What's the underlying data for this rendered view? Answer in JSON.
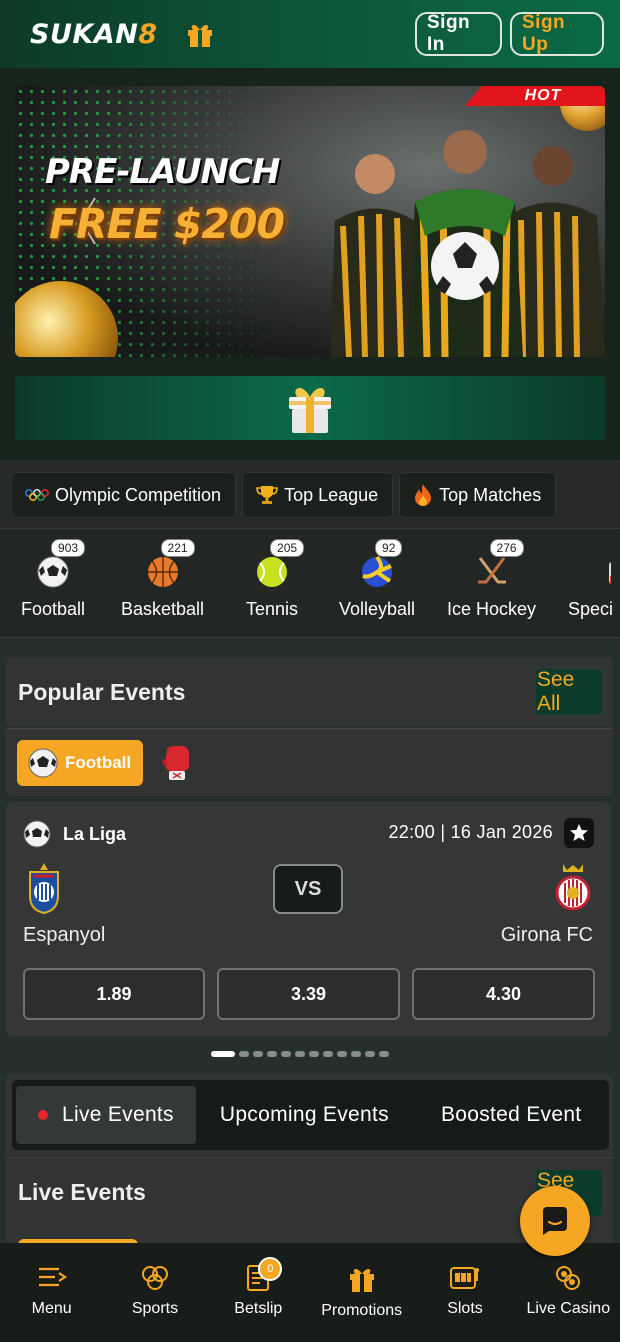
{
  "header": {
    "logo_text": "SUKAN",
    "logo_suffix": "8",
    "sign_in": "Sign In",
    "sign_up": "Sign Up"
  },
  "banner": {
    "badge": "HOT",
    "line1": "PRE-LAUNCH",
    "line2": "FREE $200"
  },
  "chips": [
    {
      "label": "Olympic Competition",
      "icon": "olympic-rings-icon"
    },
    {
      "label": "Top League",
      "icon": "trophy-icon"
    },
    {
      "label": "Top Matches",
      "icon": "fire-icon"
    }
  ],
  "sports": [
    {
      "label": "Football",
      "count": "903",
      "icon": "football-icon"
    },
    {
      "label": "Basketball",
      "count": "221",
      "icon": "basketball-icon"
    },
    {
      "label": "Tennis",
      "count": "205",
      "icon": "tennis-icon"
    },
    {
      "label": "Volleyball",
      "count": "92",
      "icon": "volleyball-icon"
    },
    {
      "label": "Ice Hockey",
      "count": "276",
      "icon": "ice-hockey-icon"
    },
    {
      "label": "Speci",
      "count": "",
      "icon": "special-icon"
    }
  ],
  "popular": {
    "title": "Popular Events",
    "see_all": "See All",
    "filter_active": "Football"
  },
  "match": {
    "league": "La Liga",
    "datetime": "22:00 | 16 Jan 2026",
    "vs": "VS",
    "home": "Espanyol",
    "away": "Girona FC",
    "odds": [
      "1.89",
      "3.39",
      "4.30"
    ]
  },
  "pager": {
    "total": 12,
    "active": 0
  },
  "tabs": [
    "Live Events",
    "Upcoming Events",
    "Boosted Event"
  ],
  "live": {
    "title": "Live Events",
    "see_all": "See All"
  },
  "bottom_nav": [
    {
      "label": "Menu",
      "icon": "menu-icon"
    },
    {
      "label": "Sports",
      "icon": "sports-icon"
    },
    {
      "label": "Betslip",
      "icon": "betslip-icon",
      "badge": "0"
    },
    {
      "label": "Promotions",
      "icon": "gift-icon"
    },
    {
      "label": "Slots",
      "icon": "slots-icon"
    },
    {
      "label": "Live Casino",
      "icon": "chips-icon"
    }
  ],
  "colors": {
    "accent": "#f5a623",
    "header_green": "#0c5b3c",
    "live_dot": "#e8232a"
  }
}
